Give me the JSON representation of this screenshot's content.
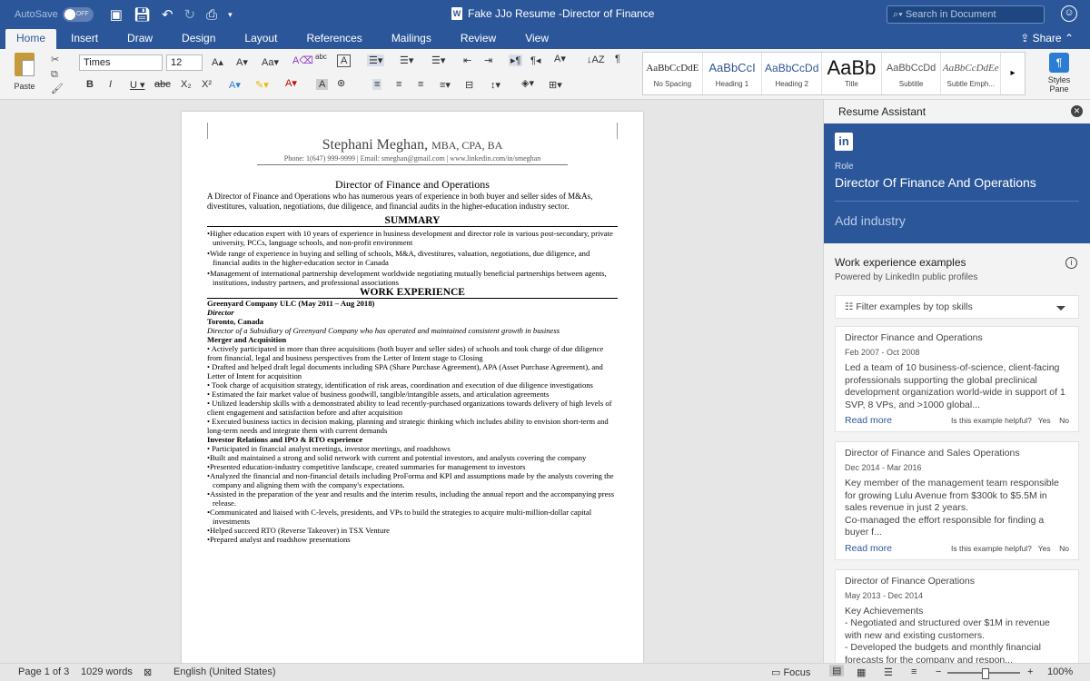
{
  "titlebar": {
    "autosave_label": "AutoSave",
    "autosave_state": "OFF",
    "doc_title": "Fake JJo Resume -Director of Finance",
    "search_placeholder": "Search in Document"
  },
  "tabs": [
    "Home",
    "Insert",
    "Draw",
    "Design",
    "Layout",
    "References",
    "Mailings",
    "Review",
    "View"
  ],
  "share_label": "Share",
  "ribbon": {
    "paste_label": "Paste",
    "font_name": "Times",
    "font_size": "12",
    "styles": [
      {
        "sample": "AaBbCcDdE",
        "name": "No Spacing"
      },
      {
        "sample": "AaBbCcI",
        "name": "Heading 1"
      },
      {
        "sample": "AaBbCcDd",
        "name": "Heading 2"
      },
      {
        "sample": "AaBb",
        "name": "Title"
      },
      {
        "sample": "AaBbCcDd",
        "name": "Subtitle"
      },
      {
        "sample": "AaBbCcDdEe",
        "name": "Subtle Emph..."
      }
    ],
    "styles_pane_label": "Styles Pane"
  },
  "document": {
    "name": "Stephani Meghan,",
    "credentials": "MBA, CPA, BA",
    "contact": "Phone: 1(647) 999-9999 | Email: smeghan@gmail.com | www.linkedin.com/in/smeghan",
    "heading": "Director of Finance and Operations",
    "intro": "A Director of Finance and Operations who has numerous years of experience in both buyer and seller sides of M&As, divestitures, valuation, negotiations, due diligence, and financial audits in the higher-education industry sector.",
    "summary_title": "SUMMARY",
    "summary": [
      "•Higher education expert with 10 years of experience in business development and director role in various post-secondary, private university, PCCs, language schools, and non-profit environment",
      "•Wide range of experience in buying and selling of schools, M&A, divestitures, valuation, negotiations, due diligence, and financial audits in the higher-education sector in Canada",
      "•Management of international partnership development worldwide negotiating mutually beneficial partnerships between agents, institutions, industry partners, and professional associations"
    ],
    "work_title": "WORK EXPERIENCE",
    "company": "Greenyard Company ULC (May 2011 – Aug 2018)",
    "position": "Director",
    "location": "Toronto, Canada",
    "company_desc": "Director of a Subsidiary of Greenyard Company who has operated and maintained consistent growth in business",
    "merger_title": "Merger and Acquisition",
    "merger": [
      "• Actively participated in more than three acquisitions (both buyer and seller sides) of schools and took charge of due diligence from financial, legal and business perspectives from the Letter of Intent stage to Closing",
      "• Drafted and helped draft legal documents including SPA (Share Purchase Agreement), APA (Asset Purchase Agreement), and Letter of Intent for acquisition",
      "• Took charge of acquisition strategy, identification of risk areas, coordination and execution of due diligence investigations",
      "• Estimated the fair market value of business goodwill, tangible/intangible assets, and articulation agreements",
      "• Utilized leadership skills with a demonstrated ability to lead recently-purchased organizations towards delivery of high levels of client engagement and satisfaction before and after acquisition",
      "• Executed business tactics in decision making, planning and strategic thinking which includes ability to envision short-term and long-term needs and integrate them with current demands"
    ],
    "ir_title": "Investor Relations and IPO & RTO experience",
    "ir": [
      "• Participated in financial analyst meetings, investor meetings, and roadshows",
      "•Built and maintained a strong and solid network with current and potential investors, and analysts covering the company",
      "•Presented education-industry competitive landscape, created summaries for management to investors",
      "•Analyzed the financial and non-financial details including ProForma and KPI and assumptions made by the analysts covering the company and aligning them with the company's expectations.",
      "•Assisted in the preparation of the year and results and the interim results, including the annual report and the accompanying press release.",
      "•Communicated and liaised with C-levels, presidents, and VPs to build the strategies to acquire multi-million-dollar capital investments",
      "•Helped succeed RTO (Reverse Takeover) in TSX Venture",
      "•Prepared analyst and roadshow presentations"
    ]
  },
  "assistant": {
    "title": "Resume Assistant",
    "linkedin_logo": "in",
    "role_label": "Role",
    "role_value": "Director Of Finance And Operations",
    "industry_placeholder": "Add industry",
    "examples_title": "Work experience examples",
    "examples_sub": "Powered by LinkedIn public profiles",
    "filter_label": "Filter examples by top skills",
    "read_more": "Read more",
    "helpful_q": "Is this example helpful?",
    "yes": "Yes",
    "no": "No",
    "cards": [
      {
        "title": "Director Finance and Operations",
        "date": "Feb 2007 - Oct 2008",
        "body": "Led a team of 10 business-of-science, client-facing professionals supporting the global preclinical development organization world-wide in support of 1 SVP, 8 VPs, and >1000 global..."
      },
      {
        "title": "Director of Finance and Sales Operations",
        "date": "Dec 2014 - Mar 2016",
        "body": "Key member of the management team responsible for growing Lulu Avenue from $300k to $5.5M in sales revenue in just 2 years.\nCo-managed the effort responsible for finding a buyer f..."
      },
      {
        "title": "Director of Finance Operations",
        "date": "May 2013 - Dec 2014",
        "body": "Key Achievements\n- Negotiated and structured over $1M in revenue with new and existing customers.\n- Developed the budgets and monthly financial forecasts for the company and respon..."
      }
    ]
  },
  "statusbar": {
    "page": "Page 1 of 3",
    "words": "1029 words",
    "language": "English (United States)",
    "focus": "Focus",
    "zoom": "100%"
  },
  "colors": {
    "brand_blue": "#2b579a",
    "page_bg": "#ffffff",
    "chrome_bg": "#f3f3f3"
  }
}
